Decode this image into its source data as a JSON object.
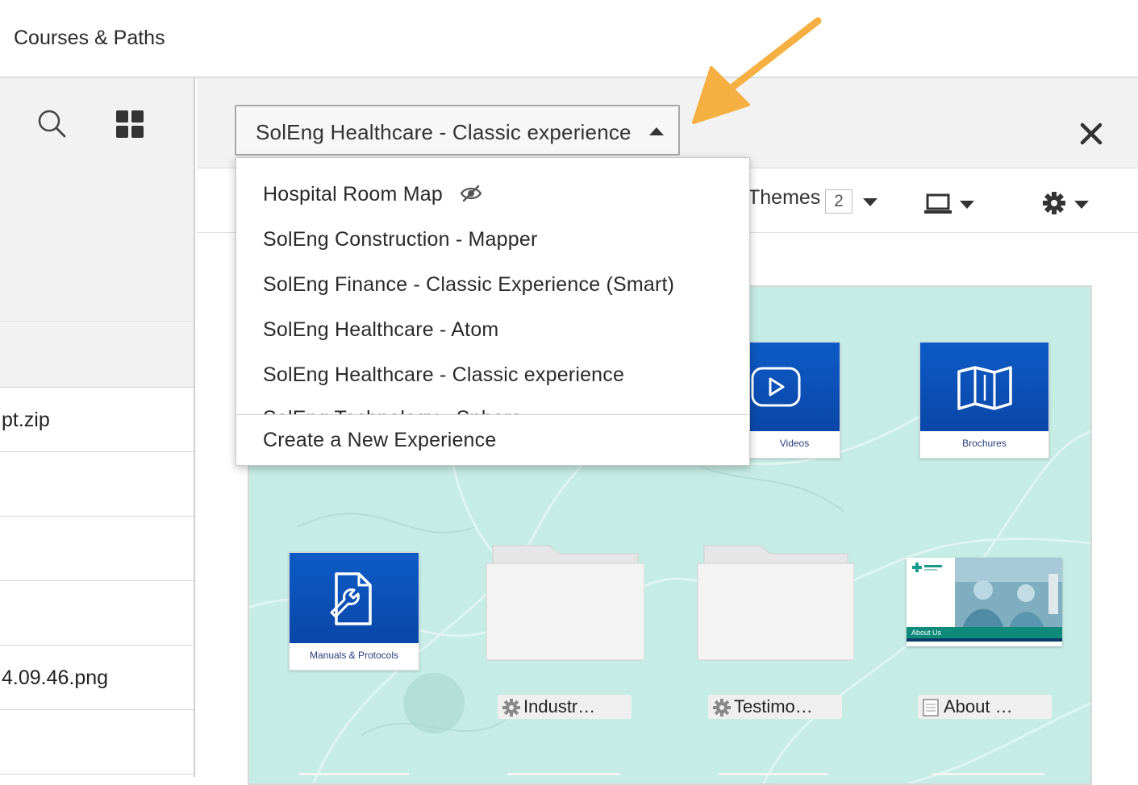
{
  "app": {
    "title": "Courses & Paths"
  },
  "left_pane": {
    "rows": [
      "",
      "pt.zip",
      "",
      "",
      "",
      "4.09.46.png",
      ""
    ]
  },
  "experience_select": {
    "selected": "SolEng Healthcare - Classic experience",
    "options": [
      {
        "label": "Hospital Room Map",
        "hidden_icon": "eye-slash-icon"
      },
      {
        "label": "SolEng Construction - Mapper"
      },
      {
        "label": "SolEng Finance - Classic Experience (Smart)"
      },
      {
        "label": "SolEng Healthcare - Atom"
      },
      {
        "label": "SolEng Healthcare - Classic experience"
      },
      {
        "label": "SolEng Technology - Sphere"
      }
    ],
    "create_label": "Create a New Experience"
  },
  "toolbar": {
    "themes_label": "Themes",
    "themes_count": "2",
    "device_icon": "laptop-icon",
    "settings_icon": "gear-icon"
  },
  "preview": {
    "tiles": [
      {
        "caption": "Videos",
        "icon": "play-icon"
      },
      {
        "caption": "Brochures",
        "icon": "map-icon"
      },
      {
        "caption": "Manuals & Protocols",
        "icon": "wrench-document-icon"
      }
    ],
    "folders": [
      {
        "label": "Industr…",
        "icon": "gear-icon"
      },
      {
        "label": "Testimo…",
        "icon": "gear-icon"
      },
      {
        "label": "About …",
        "icon": "document-icon"
      }
    ],
    "about_tile_caption": "About Us"
  },
  "colors": {
    "accent_arrow": "#f5b041",
    "tile_blue": "#0b50b8",
    "preview_bg": "#c6ece6",
    "about_band": "#0d8a7a"
  }
}
